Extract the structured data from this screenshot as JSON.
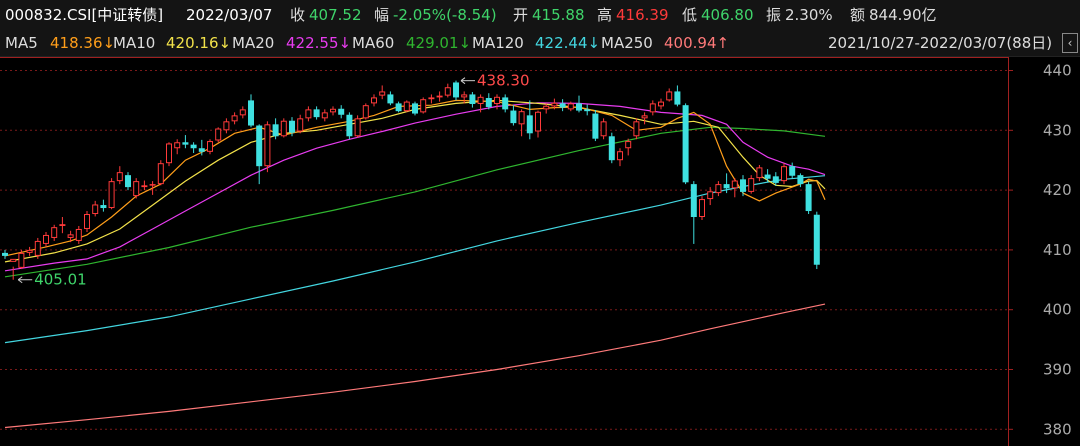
{
  "header": {
    "code": "000832.CSI[中证转债]",
    "date": "2022/03/07",
    "close_label": "收",
    "close": "407.52",
    "change_label": "幅",
    "change": "-2.05%(-8.54)",
    "open_label": "开",
    "open": "415.88",
    "high_label": "高",
    "high": "416.39",
    "low_label": "低",
    "low": "406.80",
    "amp_label": "振",
    "amp": "2.30%",
    "amount_label": "额",
    "amount": "844.90亿"
  },
  "ma_bar": {
    "ma5_label": "MA5",
    "ma5": "418.36↓",
    "ma10_label": "MA10",
    "ma10": "420.16↓",
    "ma20_label": "MA20",
    "ma20": "422.55↓",
    "ma60_label": "MA60",
    "ma60": "429.01↓",
    "ma120_label": "MA120",
    "ma120": "422.44↓",
    "ma250_label": "MA250",
    "ma250": "400.94↑",
    "range": "2021/10/27-2022/03/07(88日)",
    "collapse_icon": "chevron-left-icon"
  },
  "colors": {
    "up": "#ff3a3a",
    "down": "#3fe0e0",
    "ma5": "#ff9e1a",
    "ma10": "#f2e24a",
    "ma20": "#e83cf0",
    "ma60": "#2fb52f",
    "ma120": "#43d6e0",
    "ma250": "#ff7a7a",
    "grid": "#7a1a1a"
  },
  "chart_data": {
    "type": "candlestick",
    "ylim": [
      378,
      443
    ],
    "yticks": [
      380,
      390,
      400,
      410,
      420,
      430,
      440
    ],
    "grid": true,
    "annotations": [
      {
        "text": "438.30",
        "index": 55,
        "value": 438.3
      },
      {
        "text": "405.01",
        "index": 1,
        "value": 405.01
      }
    ],
    "candles": [
      [
        409.5,
        410.0,
        408.5,
        409.0
      ],
      [
        408.0,
        407.2,
        405.01,
        408.5
      ],
      [
        407.0,
        410.0,
        406.8,
        409.5
      ],
      [
        409.5,
        410.5,
        409.0,
        410.0
      ],
      [
        409.0,
        412.0,
        408.5,
        411.5
      ],
      [
        411.0,
        413.0,
        410.5,
        412.5
      ],
      [
        412.0,
        414.2,
        411.5,
        413.8
      ],
      [
        414.0,
        415.5,
        412.8,
        414.3
      ],
      [
        412.0,
        413.2,
        411.3,
        412.6
      ],
      [
        411.5,
        414.0,
        411.0,
        413.5
      ],
      [
        413.5,
        416.5,
        413.0,
        416.0
      ],
      [
        416.0,
        418.2,
        415.6,
        417.6
      ],
      [
        417.5,
        418.4,
        416.4,
        417.0
      ],
      [
        417.0,
        422.0,
        416.8,
        421.5
      ],
      [
        421.5,
        424.0,
        421.0,
        423.0
      ],
      [
        422.5,
        423.0,
        420.0,
        420.5
      ],
      [
        419.0,
        422.0,
        418.6,
        421.5
      ],
      [
        420.5,
        421.6,
        420.0,
        420.8
      ],
      [
        420.8,
        421.5,
        419.2,
        421.0
      ],
      [
        421.0,
        425.0,
        420.8,
        424.5
      ],
      [
        424.5,
        428.0,
        424.0,
        427.8
      ],
      [
        427.0,
        428.5,
        426.0,
        428.0
      ],
      [
        428.0,
        429.2,
        427.0,
        427.6
      ],
      [
        427.6,
        428.0,
        426.2,
        427.0
      ],
      [
        427.0,
        428.4,
        425.8,
        426.4
      ],
      [
        426.4,
        428.5,
        426.0,
        428.2
      ],
      [
        428.3,
        430.5,
        428.0,
        430.3
      ],
      [
        430.0,
        432.0,
        429.5,
        431.5
      ],
      [
        431.5,
        433.0,
        431.0,
        432.5
      ],
      [
        432.5,
        434.0,
        432.0,
        433.5
      ],
      [
        435.0,
        436.0,
        430.5,
        430.8
      ],
      [
        430.8,
        431.0,
        421.0,
        424.0
      ],
      [
        424.0,
        431.5,
        423.0,
        431.0
      ],
      [
        431.0,
        432.0,
        428.5,
        429.0
      ],
      [
        429.0,
        432.0,
        428.8,
        431.6
      ],
      [
        431.6,
        432.2,
        429.0,
        429.6
      ],
      [
        429.8,
        432.6,
        429.5,
        432.0
      ],
      [
        432.0,
        434.0,
        431.5,
        433.5
      ],
      [
        433.5,
        434.0,
        431.8,
        432.2
      ],
      [
        432.0,
        433.5,
        431.5,
        433.0
      ],
      [
        433.0,
        434.0,
        432.5,
        433.6
      ],
      [
        433.6,
        434.2,
        432.0,
        432.6
      ],
      [
        432.6,
        433.0,
        428.5,
        429.0
      ],
      [
        429.0,
        432.5,
        428.8,
        432.0
      ],
      [
        432.0,
        434.5,
        431.8,
        434.2
      ],
      [
        434.5,
        436.0,
        434.0,
        435.5
      ],
      [
        435.8,
        437.5,
        435.2,
        436.5
      ],
      [
        436.0,
        436.5,
        434.2,
        434.5
      ],
      [
        434.5,
        434.8,
        433.0,
        433.2
      ],
      [
        433.2,
        435.0,
        433.0,
        434.8
      ],
      [
        434.5,
        434.8,
        432.5,
        432.8
      ],
      [
        433.0,
        435.5,
        432.8,
        435.2
      ],
      [
        435.2,
        436.0,
        434.5,
        435.5
      ],
      [
        435.5,
        436.5,
        434.8,
        435.8
      ],
      [
        435.8,
        437.8,
        435.5,
        437.2
      ],
      [
        438.0,
        438.3,
        435.0,
        435.5
      ],
      [
        435.5,
        436.5,
        434.5,
        436.0
      ],
      [
        436.0,
        436.4,
        433.8,
        434.4
      ],
      [
        434.4,
        436.0,
        433.0,
        435.6
      ],
      [
        435.4,
        436.2,
        433.5,
        433.9
      ]
    ],
    "candles_b": [
      [
        434.4,
        436.0,
        433.5,
        435.6
      ],
      [
        435.5,
        436.0,
        433.0,
        433.5
      ],
      [
        433.3,
        434.2,
        430.8,
        431.2
      ],
      [
        431.0,
        433.5,
        429.0,
        433.2
      ],
      [
        432.5,
        435.0,
        428.5,
        429.5
      ],
      [
        429.8,
        433.3,
        428.8,
        433.1
      ],
      [
        433.5,
        434.5,
        432.8,
        434.1
      ],
      [
        434.0,
        435.3,
        433.5,
        434.6
      ],
      [
        434.5,
        435.2,
        433.2,
        433.8
      ],
      [
        433.5,
        434.8,
        433.2,
        434.5
      ],
      [
        434.5,
        435.8,
        433.0,
        433.3
      ],
      [
        433.5,
        434.3,
        432.5,
        433.2
      ],
      [
        432.8,
        433.4,
        428.2,
        428.6
      ],
      [
        429.0,
        432.0,
        428.5,
        431.5
      ],
      [
        429.0,
        429.6,
        424.5,
        425.0
      ],
      [
        425.0,
        427.0,
        424.0,
        426.5
      ],
      [
        427.0,
        428.6,
        425.8,
        428.2
      ],
      [
        429.0,
        432.0,
        428.5,
        431.5
      ],
      [
        432.0,
        433.0,
        431.0,
        432.5
      ],
      [
        433.0,
        435.0,
        432.5,
        434.5
      ],
      [
        434.0,
        435.3,
        433.5,
        434.8
      ],
      [
        435.0,
        437.0,
        434.8,
        436.5
      ],
      [
        436.5,
        437.5,
        434.0,
        434.3
      ],
      [
        434.2,
        434.5,
        421.0,
        421.3
      ],
      [
        421.0,
        421.5,
        411.0,
        415.5
      ],
      [
        415.5,
        419.0,
        415.0,
        418.5
      ],
      [
        418.5,
        420.5,
        417.5,
        419.8
      ],
      [
        419.5,
        421.5,
        419.0,
        421.0
      ],
      [
        421.0,
        422.8,
        419.5,
        420.3
      ],
      [
        420.3,
        422.0,
        418.8,
        421.6
      ],
      [
        421.8,
        422.5,
        419.0,
        419.7
      ],
      [
        419.7,
        422.5,
        419.4,
        422.0
      ],
      [
        422.0,
        424.2,
        421.5,
        423.8
      ],
      [
        422.6,
        423.5,
        421.4,
        421.9
      ],
      [
        422.3,
        423.0,
        420.7,
        421.2
      ],
      [
        421.5,
        424.5,
        421.0,
        424.0
      ],
      [
        424.0,
        424.6,
        422.0,
        422.4
      ],
      [
        422.5,
        422.8,
        420.5,
        421.0
      ],
      [
        421.0,
        421.4,
        416.0,
        416.5
      ],
      [
        415.88,
        416.39,
        406.8,
        407.52
      ]
    ],
    "series": [
      {
        "name": "MA5",
        "values": [
          [
            0,
            409.0
          ],
          [
            5,
            410.5
          ],
          [
            8,
            411.5
          ],
          [
            10,
            412.5
          ],
          [
            13,
            415.5
          ],
          [
            16,
            419.0
          ],
          [
            19,
            421.0
          ],
          [
            22,
            425.0
          ],
          [
            25,
            427.0
          ],
          [
            28,
            429.5
          ],
          [
            31,
            430.5
          ],
          [
            34,
            429.2
          ],
          [
            38,
            430.5
          ],
          [
            42,
            431.5
          ],
          [
            45,
            432.5
          ],
          [
            48,
            434.0
          ],
          [
            52,
            434.2
          ],
          [
            55,
            435.0
          ],
          [
            60,
            434.8
          ],
          [
            64,
            433.5
          ],
          [
            67,
            433.8
          ],
          [
            70,
            433.9
          ],
          [
            74,
            432.5
          ],
          [
            77,
            430.0
          ],
          [
            80,
            430.5
          ],
          [
            82,
            432.0
          ],
          [
            84,
            433.0
          ],
          [
            86,
            431.0
          ],
          [
            88,
            424.0
          ],
          [
            90,
            419.5
          ],
          [
            92,
            418.2
          ],
          [
            94,
            419.5
          ],
          [
            96,
            420.5
          ],
          [
            97,
            421.0
          ],
          [
            98,
            421.8
          ],
          [
            99,
            421.5
          ],
          [
            100,
            418.4
          ]
        ]
      },
      {
        "name": "MA10",
        "values": [
          [
            0,
            408.0
          ],
          [
            6,
            409.5
          ],
          [
            10,
            411.0
          ],
          [
            14,
            413.5
          ],
          [
            18,
            417.5
          ],
          [
            22,
            421.5
          ],
          [
            26,
            425.0
          ],
          [
            30,
            428.0
          ],
          [
            34,
            429.5
          ],
          [
            38,
            430.0
          ],
          [
            42,
            431.0
          ],
          [
            46,
            432.0
          ],
          [
            50,
            433.5
          ],
          [
            55,
            434.5
          ],
          [
            60,
            435.0
          ],
          [
            65,
            434.5
          ],
          [
            70,
            433.8
          ],
          [
            75,
            432.5
          ],
          [
            80,
            431.0
          ],
          [
            84,
            431.5
          ],
          [
            87,
            430.5
          ],
          [
            90,
            425.5
          ],
          [
            92,
            422.5
          ],
          [
            94,
            420.8
          ],
          [
            96,
            420.6
          ],
          [
            98,
            421.5
          ],
          [
            99,
            421.6
          ],
          [
            100,
            420.2
          ]
        ]
      },
      {
        "name": "MA20",
        "values": [
          [
            0,
            406.5
          ],
          [
            6,
            407.8
          ],
          [
            10,
            408.5
          ],
          [
            14,
            410.5
          ],
          [
            18,
            413.5
          ],
          [
            22,
            416.5
          ],
          [
            26,
            419.5
          ],
          [
            30,
            422.5
          ],
          [
            34,
            425.0
          ],
          [
            38,
            427.0
          ],
          [
            42,
            428.5
          ],
          [
            46,
            429.8
          ],
          [
            50,
            431.2
          ],
          [
            55,
            432.7
          ],
          [
            60,
            434.0
          ],
          [
            65,
            434.6
          ],
          [
            70,
            434.5
          ],
          [
            75,
            434.0
          ],
          [
            80,
            433.0
          ],
          [
            85,
            432.5
          ],
          [
            88,
            431.0
          ],
          [
            90,
            428.0
          ],
          [
            93,
            425.5
          ],
          [
            96,
            424.0
          ],
          [
            98,
            423.5
          ],
          [
            100,
            422.6
          ]
        ]
      },
      {
        "name": "MA60",
        "values": [
          [
            0,
            405.5
          ],
          [
            10,
            407.6
          ],
          [
            20,
            410.4
          ],
          [
            30,
            413.8
          ],
          [
            40,
            416.6
          ],
          [
            50,
            419.7
          ],
          [
            60,
            423.4
          ],
          [
            70,
            426.6
          ],
          [
            80,
            429.5
          ],
          [
            86,
            430.5
          ],
          [
            90,
            430.3
          ],
          [
            95,
            429.9
          ],
          [
            100,
            429.0
          ]
        ]
      },
      {
        "name": "MA120",
        "values": [
          [
            0,
            394.5
          ],
          [
            10,
            396.5
          ],
          [
            20,
            398.8
          ],
          [
            30,
            401.8
          ],
          [
            40,
            404.8
          ],
          [
            50,
            408.0
          ],
          [
            60,
            411.5
          ],
          [
            70,
            414.6
          ],
          [
            80,
            417.5
          ],
          [
            86,
            419.5
          ],
          [
            90,
            420.6
          ],
          [
            95,
            421.8
          ],
          [
            100,
            422.4
          ]
        ]
      },
      {
        "name": "MA250",
        "values": [
          [
            0,
            380.3
          ],
          [
            10,
            381.6
          ],
          [
            20,
            383.0
          ],
          [
            30,
            384.6
          ],
          [
            40,
            386.2
          ],
          [
            50,
            388.0
          ],
          [
            60,
            390.0
          ],
          [
            70,
            392.3
          ],
          [
            80,
            394.9
          ],
          [
            86,
            396.8
          ],
          [
            90,
            398.0
          ],
          [
            95,
            399.5
          ],
          [
            100,
            400.94
          ]
        ]
      }
    ]
  }
}
